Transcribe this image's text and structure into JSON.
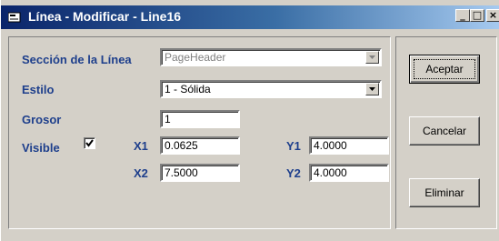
{
  "window": {
    "title": "Línea - Modificar - Line16",
    "controls": {
      "minimize": "_",
      "maximize": "□",
      "close": "×"
    }
  },
  "form": {
    "section": {
      "label": "Sección de la Línea",
      "value": "PageHeader"
    },
    "style": {
      "label": "Estilo",
      "value": "1 - Sólida"
    },
    "thickness": {
      "label": "Grosor",
      "value": "1"
    },
    "visible": {
      "label": "Visible",
      "checked": true
    },
    "x1": {
      "label": "X1",
      "value": "0.0625"
    },
    "y1": {
      "label": "Y1",
      "value": "4.0000"
    },
    "x2": {
      "label": "X2",
      "value": "7.5000"
    },
    "y2": {
      "label": "Y2",
      "value": "4.0000"
    }
  },
  "buttons": {
    "accept": "Aceptar",
    "cancel": "Cancelar",
    "delete": "Eliminar"
  },
  "colors": {
    "label": "#1e3f8c",
    "titlebar_start": "#0a246a",
    "titlebar_end": "#a6caf0",
    "face": "#d4d0c8"
  }
}
